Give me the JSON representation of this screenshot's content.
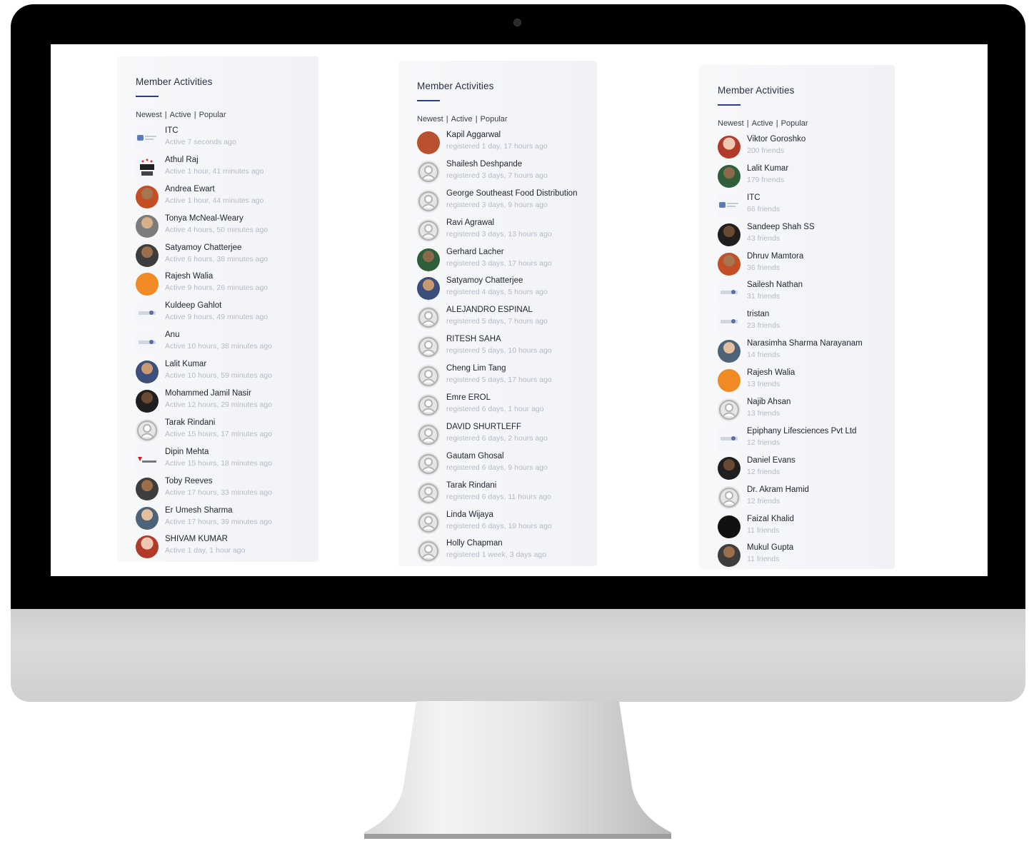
{
  "panels": [
    {
      "title": "Member Activities",
      "filters": [
        "Newest",
        "Active",
        "Popular"
      ],
      "members": [
        {
          "name": "ITC",
          "meta": "Active 7 seconds ago",
          "avatar": "logo-itc"
        },
        {
          "name": "Athul Raj",
          "meta": "Active 1 hour, 41 minutes ago",
          "avatar": "logo-seo"
        },
        {
          "name": "Andrea Ewart",
          "meta": "Active 1 hour, 44 minutes ago",
          "avatar": "photo"
        },
        {
          "name": "Tonya McNeal-Weary",
          "meta": "Active 4 hours, 50 minutes ago",
          "avatar": "photo"
        },
        {
          "name": "Satyamoy Chatterjee",
          "meta": "Active 6 hours, 38 minutes ago",
          "avatar": "photo"
        },
        {
          "name": "Rajesh Walia",
          "meta": "Active 9 hours, 26 minutes ago",
          "avatar": "orange"
        },
        {
          "name": "Kuldeep Gahlot",
          "meta": "Active 9 hours, 49 minutes ago",
          "avatar": "logo"
        },
        {
          "name": "Anu",
          "meta": "Active 10 hours, 38 minutes ago",
          "avatar": "logo"
        },
        {
          "name": "Lalit Kumar",
          "meta": "Active 10 hours, 59 minutes ago",
          "avatar": "photo"
        },
        {
          "name": "Mohammed Jamil Nasir",
          "meta": "Active 12 hours, 29 minutes ago",
          "avatar": "photo"
        },
        {
          "name": "Tarak Rindani",
          "meta": "Active 15 hours, 17 minutes ago",
          "avatar": "default"
        },
        {
          "name": "Dipin Mehta",
          "meta": "Active 15 hours, 18 minutes ago",
          "avatar": "logo-metrix"
        },
        {
          "name": "Toby Reeves",
          "meta": "Active 17 hours, 33 minutes ago",
          "avatar": "photo"
        },
        {
          "name": "Er Umesh Sharma",
          "meta": "Active 17 hours, 39 minutes ago",
          "avatar": "photo"
        },
        {
          "name": "SHIVAM KUMAR",
          "meta": "Active 1 day, 1 hour ago",
          "avatar": "photo"
        }
      ]
    },
    {
      "title": "Member Activities",
      "filters": [
        "Newest",
        "Active",
        "Popular"
      ],
      "members": [
        {
          "name": "Kapil Aggarwal",
          "meta": "registered 1 day, 17 hours ago",
          "avatar": "red"
        },
        {
          "name": "Shailesh Deshpande",
          "meta": "registered 3 days, 7 hours ago",
          "avatar": "default"
        },
        {
          "name": "George Southeast Food Distribution",
          "meta": "registered 3 days, 9 hours ago",
          "avatar": "default"
        },
        {
          "name": "Ravi Agrawal",
          "meta": "registered 3 days, 13 hours ago",
          "avatar": "default"
        },
        {
          "name": "Gerhard Lacher",
          "meta": "registered 3 days, 17 hours ago",
          "avatar": "photo"
        },
        {
          "name": "Satyamoy Chatterjee",
          "meta": "registered 4 days, 5 hours ago",
          "avatar": "photo"
        },
        {
          "name": "ALEJANDRO ESPINAL",
          "meta": "registered 5 days, 7 hours ago",
          "avatar": "default"
        },
        {
          "name": "RITESH SAHA",
          "meta": "registered 5 days, 10 hours ago",
          "avatar": "default"
        },
        {
          "name": "Cheng Lim Tang",
          "meta": "registered 5 days, 17 hours ago",
          "avatar": "default"
        },
        {
          "name": "Emre EROL",
          "meta": "registered 6 days, 1 hour ago",
          "avatar": "default"
        },
        {
          "name": "DAVID SHURTLEFF",
          "meta": "registered 6 days, 2 hours ago",
          "avatar": "default"
        },
        {
          "name": "Gautam Ghosal",
          "meta": "registered 6 days, 9 hours ago",
          "avatar": "default"
        },
        {
          "name": "Tarak Rindani",
          "meta": "registered 6 days, 11 hours ago",
          "avatar": "default"
        },
        {
          "name": "Linda Wijaya",
          "meta": "registered 6 days, 19 hours ago",
          "avatar": "default"
        },
        {
          "name": "Holly Chapman",
          "meta": "registered 1 week, 3 days ago",
          "avatar": "default"
        }
      ]
    },
    {
      "title": "Member Activities",
      "filters": [
        "Newest",
        "Active",
        "Popular"
      ],
      "members": [
        {
          "name": "Viktor Goroshko",
          "meta": "200 friends",
          "avatar": "photo"
        },
        {
          "name": "Lalit Kumar",
          "meta": "179 friends",
          "avatar": "photo"
        },
        {
          "name": "ITC",
          "meta": "66 friends",
          "avatar": "logo-itc"
        },
        {
          "name": "Sandeep Shah SS",
          "meta": "43 friends",
          "avatar": "photo"
        },
        {
          "name": "Dhruv Mamtora",
          "meta": "36 friends",
          "avatar": "photo"
        },
        {
          "name": "Sailesh Nathan",
          "meta": "31 friends",
          "avatar": "logo"
        },
        {
          "name": "tristan",
          "meta": "23 friends",
          "avatar": "logo"
        },
        {
          "name": "Narasimha Sharma Narayanam",
          "meta": "14 friends",
          "avatar": "photo"
        },
        {
          "name": "Rajesh Walia",
          "meta": "13 friends",
          "avatar": "orange"
        },
        {
          "name": "Najib Ahsan",
          "meta": "13 friends",
          "avatar": "default"
        },
        {
          "name": "Epiphany Lifesciences Pvt Ltd",
          "meta": "12 friends",
          "avatar": "logo"
        },
        {
          "name": "Daniel Evans",
          "meta": "12 friends",
          "avatar": "photo"
        },
        {
          "name": "Dr. Akram Hamid",
          "meta": "12 friends",
          "avatar": "default"
        },
        {
          "name": "Faizal Khalid",
          "meta": "11 friends",
          "avatar": "black"
        },
        {
          "name": "Mukul Gupta",
          "meta": "11 friends",
          "avatar": "photo"
        }
      ]
    }
  ],
  "colors": {
    "title_underline": "#2b3b8f",
    "meta_text": "#b5b9c7",
    "name_text": "#1f2230",
    "bezel": "#000000",
    "chin": "#d3d3d3"
  }
}
